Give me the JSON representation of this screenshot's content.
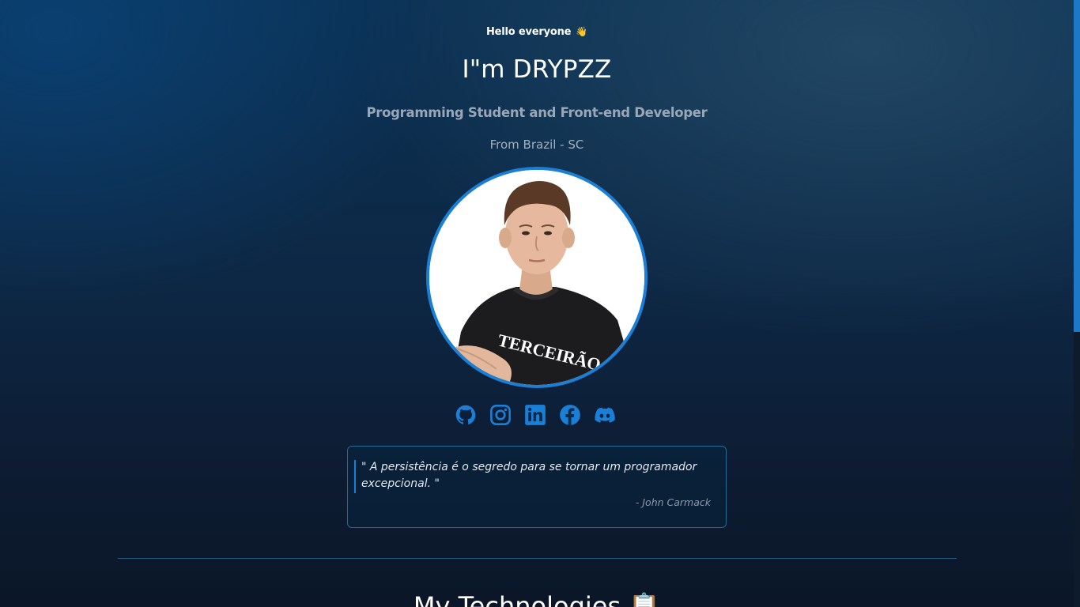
{
  "hero": {
    "greeting": "Hello everyone",
    "greeting_emoji": "👋",
    "title": "I\"m DRYPZZ",
    "subtitle": "Programming Student and Front-end Developer",
    "location": "From Brazil - SC",
    "shirt_text": "TERCEIRÃO"
  },
  "socials": [
    {
      "name": "github-icon"
    },
    {
      "name": "instagram-icon"
    },
    {
      "name": "linkedin-icon"
    },
    {
      "name": "facebook-icon"
    },
    {
      "name": "discord-icon"
    }
  ],
  "quote": {
    "text": "\" A persistência é o segredo para se tornar um programador excepcional. \"",
    "author": "- John Carmack"
  },
  "section": {
    "title": "My Technologies",
    "emoji": "📋"
  },
  "colors": {
    "accent": "#1a7fd6",
    "background": "#0d2845",
    "muted_text": "#9aa7b7"
  }
}
